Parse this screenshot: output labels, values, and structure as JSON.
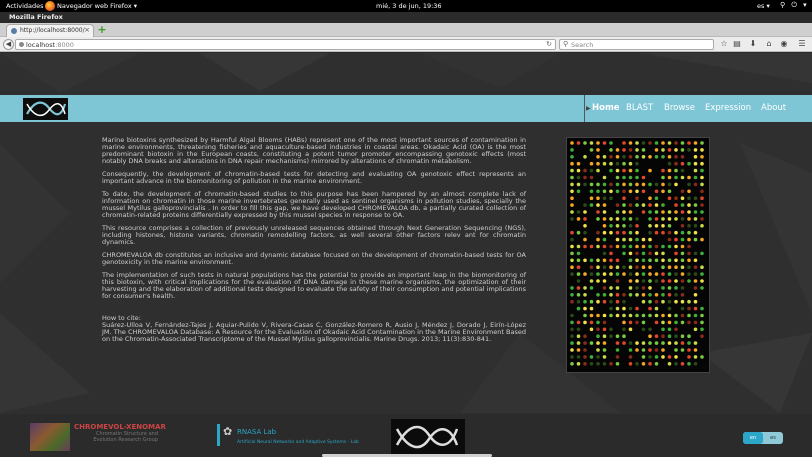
{
  "system_bar": {
    "activities": "Actividades",
    "app_name": "Navegador web Firefox ▾",
    "clock": "mié, 3 de jun, 19:36",
    "keyboard_lang": "es ▾",
    "status_icons": "⚲ ⏻ ▾"
  },
  "window": {
    "title": "Mozilla Firefox"
  },
  "browser": {
    "tab_label": "http://localhost:8000/",
    "new_tab": "+",
    "url_host": "localhost",
    "url_port": ":8000",
    "search_placeholder": "Search"
  },
  "site": {
    "nav": [
      {
        "label": "Home",
        "active": true
      },
      {
        "label": "BLAST",
        "active": false
      },
      {
        "label": "Browse",
        "active": false
      },
      {
        "label": "Expression",
        "active": false
      },
      {
        "label": "About",
        "active": false
      }
    ],
    "paragraphs": [
      "Marine biotoxins synthesized by Harmful Algal Blooms (HABs) represent one of the most important sources of contamination in marine environments, threatening fisheries and aquaculture-based industries in coastal areas. Okadaic Acid (OA) is the most predominant biotoxin in the European coasts, constituting a potent tumor promoter encompassing genotoxic effects (most notably DNA breaks and alterations in DNA repair mechanisms) mirrored by alterations of chromatin metabolism.",
      "Consequently, the development of chromatin-based tests for detecting and evaluating OA genotoxic effect represents an important advance in the biomonitoring of pollution in the marine environment.",
      "To date, the development of chromatin-based studies to this purpose has been hampered by an almost complete lack of information on chromatin in those marine invertebrates generally used as sentinel organisms in pollution studies, specially the mussel Mytilus galloprovincialis . In order to fill this gap, we have developed CHROMEVALOA db, a partially curated collection of chromatin-related proteins differentially expressed by this mussel species in response to OA.",
      "This resource comprises a collection of previously unreleased sequences obtained through Next Generation Sequencing (NGS), including histones, histone variants, chromatin remodelling factors, as well several other factors relev ant for chromatin dynamics.",
      "CHROMEVALOA db constitutes an inclusive and dynamic database focused on the development of chromatin-based tests for OA genotoxicity in the marine environment.",
      "The implementation of such tests in natural populations has the potential to provide an important leap in the biomonitoring of this biotoxin, with critical implications for the evaluation of DNA damage in these marine organisms, the optimization of their harvesting and the elaboration of additional tests designed to evaluate the safety of their consumption and potential implications for consumer's health."
    ],
    "cite_heading": "How to cite:",
    "citation": "Suárez-Ulloa V, Fernández-Tajes J, Aguiar-Pulido V, Rivera-Casas C, González-Romero R, Ausio J, Méndez J, Dorado J, Eirín-López JM. The CHROMEVALOA Database: A Resource for the Evaluation of Okadaic Acid Contamination in the Marine Environment Based on the Chromatin-Associated Transcriptome of the Mussel Mytilus galloprovincialis. Marine Drugs. 2013; 11(3):830-841.",
    "footer": {
      "partner1_title": "CHROMEVOL-XENOMAR",
      "partner1_sub": "Chromatin Structure and Evolution Research Group",
      "partner2_title": "RNASA Lab",
      "partner2_sub": "Artificial Neural Networks and Adaptive Systems - Lab",
      "lang_en": "en",
      "lang_es": "es"
    }
  },
  "colors": {
    "header_accent": "#7ec6d6",
    "brand_blue": "#2aa7c9",
    "page_bg": "#2f2f2f"
  },
  "icons": [
    "firefox-icon",
    "close-icon",
    "back-icon",
    "reload-icon",
    "search-icon",
    "star-icon",
    "reader-icon",
    "download-icon",
    "home-icon",
    "sync-icon",
    "menu-icon",
    "frog-icon"
  ]
}
